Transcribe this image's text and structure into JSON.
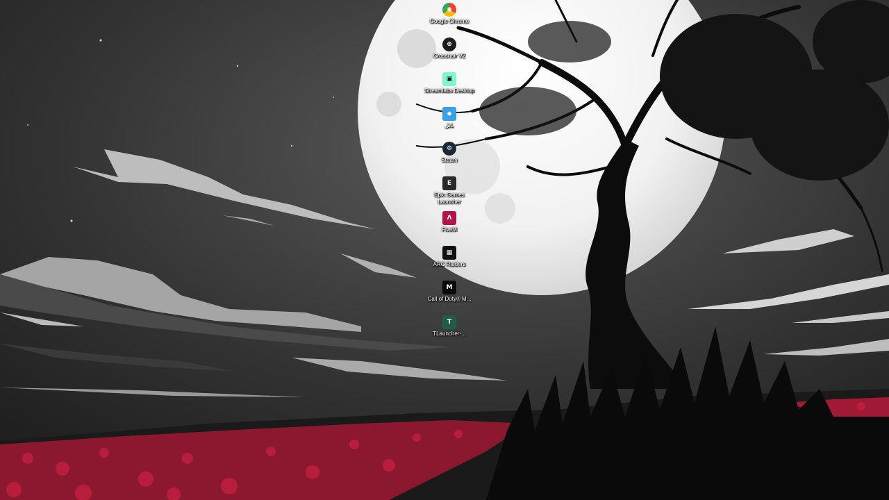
{
  "desktop": {
    "icons": [
      {
        "label": "Google Chrome",
        "icon": "chrome-icon",
        "color": "#ffffff"
      },
      {
        "label": "Crosshair V2",
        "icon": "crosshair-icon",
        "color": "#1c1c1c"
      },
      {
        "label": "Streamlabs Desktop",
        "icon": "streamlabs-icon",
        "color": "#80f5d2"
      },
      {
        "label": "بابل",
        "icon": "app-icon",
        "color": "#3aa0e6"
      },
      {
        "label": "Steam",
        "icon": "steam-icon",
        "color": "#1b2838"
      },
      {
        "label": "Epic Games Launcher",
        "icon": "epic-games-icon",
        "color": "#2a2a2a"
      },
      {
        "label": "FiveM",
        "icon": "fivem-icon",
        "color": "#b3124a"
      },
      {
        "label": "ARC Raiders",
        "icon": "arc-raiders-icon",
        "color": "#111111"
      },
      {
        "label": "Call of Duty® M...",
        "icon": "call-of-duty-icon",
        "color": "#0a0a0a"
      },
      {
        "label": "TLauncher-...",
        "icon": "tlauncher-icon",
        "color": "#1f5d4a"
      }
    ]
  }
}
